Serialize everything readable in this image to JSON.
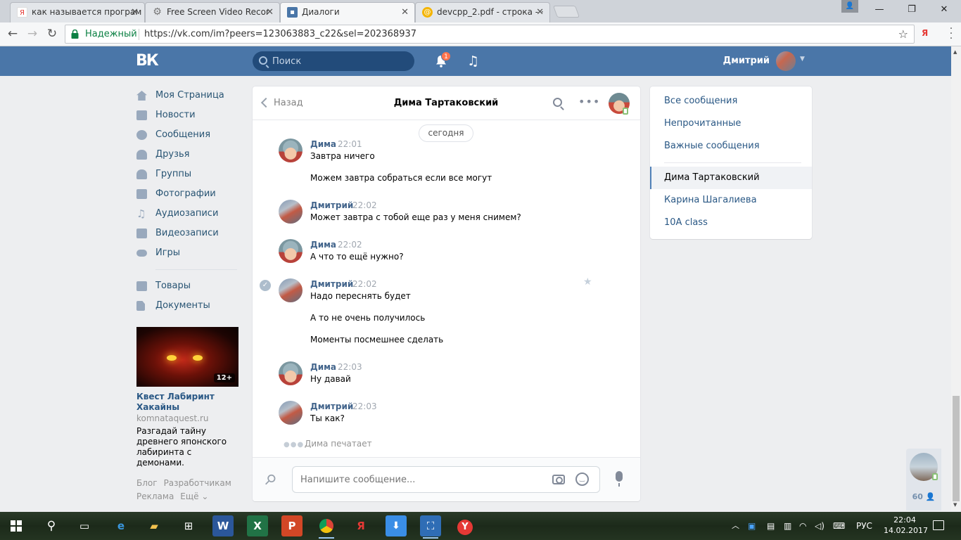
{
  "browser": {
    "tabs": [
      {
        "title": "как называется програм",
        "favicon": "yandex-icon",
        "active": false
      },
      {
        "title": "Free Screen Video Recor",
        "favicon": "gear-icon",
        "active": false
      },
      {
        "title": "Диалоги",
        "favicon": "vk-icon",
        "active": true
      },
      {
        "title": "devcpp_2.pdf - строка - ·",
        "favicon": "pdf-icon",
        "active": false
      }
    ],
    "secure_label": "Надежный",
    "url": "https://vk.com/im?peers=123063883_c22&sel=202368937",
    "extension_label": "Я"
  },
  "vk": {
    "logo": "ВК",
    "search_placeholder": "Поиск",
    "notification_count": "1",
    "user_name": "Дмитрий"
  },
  "left_menu": {
    "items": [
      {
        "label": "Моя Страница",
        "icon": "home-icon"
      },
      {
        "label": "Новости",
        "icon": "news-icon"
      },
      {
        "label": "Сообщения",
        "icon": "messages-icon"
      },
      {
        "label": "Друзья",
        "icon": "friends-icon"
      },
      {
        "label": "Группы",
        "icon": "groups-icon"
      },
      {
        "label": "Фотографии",
        "icon": "camera-icon"
      },
      {
        "label": "Аудиозаписи",
        "icon": "music-icon"
      },
      {
        "label": "Видеозаписи",
        "icon": "video-icon"
      },
      {
        "label": "Игры",
        "icon": "gamepad-icon"
      }
    ],
    "extra_items": [
      {
        "label": "Товары",
        "icon": "bag-icon"
      },
      {
        "label": "Документы",
        "icon": "document-icon"
      }
    ]
  },
  "ad": {
    "age_badge": "12+",
    "title": "Квест Лабиринт Хакайны",
    "domain": "komnataquest.ru",
    "description": "Разгадай тайну древнего японского лабиринта с демонами."
  },
  "footer": {
    "blog": "Блог",
    "developers": "Разработчикам",
    "ads": "Реклама",
    "more": "Ещё ⌄"
  },
  "dialog": {
    "back_label": "Назад",
    "title": "Дима Тартаковский",
    "date_label": "сегодня",
    "groups": [
      {
        "author": "Дима",
        "time": "22:01",
        "avatar": "dima",
        "lines": [
          "Завтра ничего",
          "Можем завтра собраться если все могут"
        ]
      },
      {
        "author": "Дмитрий",
        "time": "22:02",
        "avatar": "dmitry",
        "lines": [
          "Может завтра с тобой еще раз у меня снимем?"
        ]
      },
      {
        "author": "Дима",
        "time": "22:02",
        "avatar": "dima",
        "lines": [
          "А что то ещё нужно?"
        ]
      },
      {
        "author": "Дмитрий",
        "time": "22:02",
        "avatar": "dmitry",
        "lines": [
          "Надо переснять будет",
          "А то не очень получилось",
          "Моменты посмешнее сделать"
        ]
      },
      {
        "author": "Дима",
        "time": "22:03",
        "avatar": "dima",
        "lines": [
          "Ну давай"
        ]
      },
      {
        "author": "Дмитрий",
        "time": "22:03",
        "avatar": "dmitry",
        "lines": [
          "Ты как?"
        ]
      }
    ],
    "typing": "Дима печатает",
    "compose_placeholder": "Напишите сообщение..."
  },
  "right_panel": {
    "filters": [
      "Все сообщения",
      "Непрочитанные",
      "Важные сообщения"
    ],
    "conversations": [
      "Дима Тартаковский",
      "Карина Шагалиева",
      "10А class"
    ],
    "selected": "Дима Тартаковский"
  },
  "friends_widget": {
    "online_count": "60"
  },
  "taskbar": {
    "language": "РУС",
    "time": "22:04",
    "date": "14.02.2017"
  }
}
